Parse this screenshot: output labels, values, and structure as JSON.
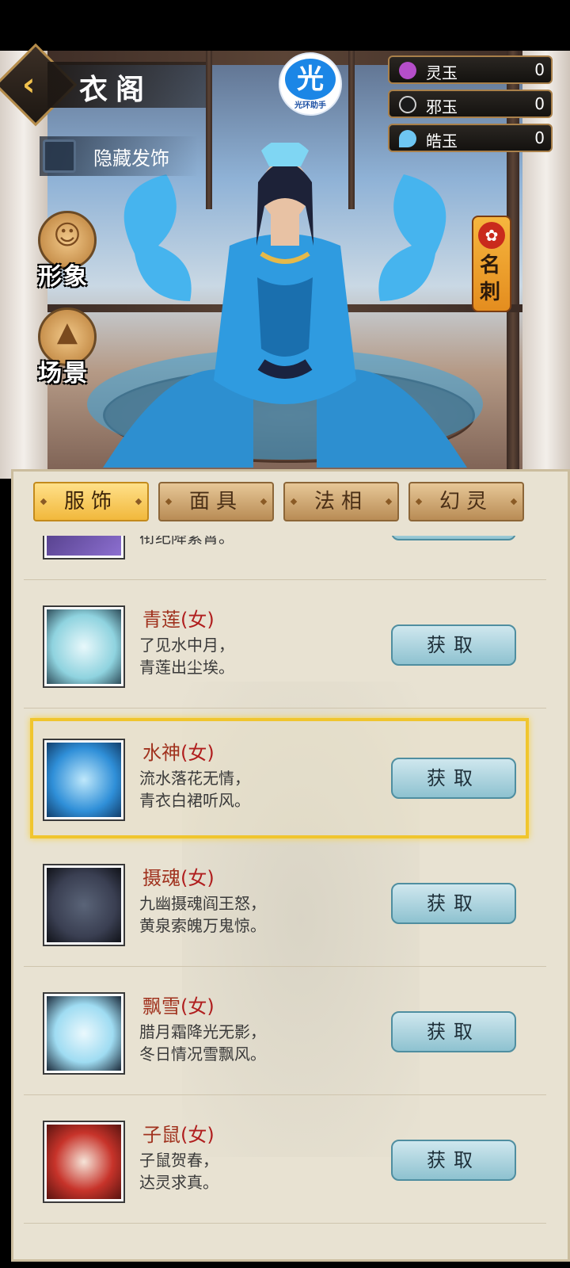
{
  "header": {
    "title": "衣阁",
    "logo_glyph": "光",
    "logo_text": "光环助手",
    "hide_hair_label": "隐藏发饰"
  },
  "currencies": [
    {
      "name": "灵玉",
      "value": "0",
      "icon_color": "#b54ec9"
    },
    {
      "name": "邪玉",
      "value": "0",
      "icon_color": "#cfcfcf"
    },
    {
      "name": "皓玉",
      "value": "0",
      "icon_color": "#6ec6f2"
    }
  ],
  "side": {
    "appearance_label": "形象",
    "scene_label": "场景",
    "card_label": "名刺"
  },
  "tabs": [
    {
      "label": "服饰",
      "active": true
    },
    {
      "label": "面具",
      "active": false
    },
    {
      "label": "法相",
      "active": false
    },
    {
      "label": "幻灵",
      "active": false
    }
  ],
  "list": {
    "partial_top_desc": "衔纪降紫霄。",
    "items": [
      {
        "name": "青莲",
        "gender": "(女)",
        "line1": "了见水中月，",
        "line2": "青莲出尘埃。",
        "button": "获取",
        "selected": false,
        "tint": "#8fd3df"
      },
      {
        "name": "水神",
        "gender": "(女)",
        "line1": "流水落花无情，",
        "line2": "青衣白裙听风。",
        "button": "获取",
        "selected": true,
        "tint": "#2f8fd8"
      },
      {
        "name": "摄魂",
        "gender": "(女)",
        "line1": "九幽摄魂阎王怒，",
        "line2": "黄泉索魄万鬼惊。",
        "button": "获取",
        "selected": false,
        "tint": "#3a3f52"
      },
      {
        "name": "飘雪",
        "gender": "(女)",
        "line1": "腊月霜降光无影，",
        "line2": "冬日情况雪飘风。",
        "button": "获取",
        "selected": false,
        "tint": "#9fdcf2"
      },
      {
        "name": "子鼠",
        "gender": "(女)",
        "line1": "子鼠贺春，",
        "line2": "达灵求真。",
        "button": "获取",
        "selected": false,
        "tint": "#c7332a"
      }
    ]
  },
  "colors": {
    "panel_bg": "#e8e2d2",
    "active_tab": "#f1b83c",
    "selected_border": "#f0c52e",
    "name_red": "#a0321e"
  }
}
